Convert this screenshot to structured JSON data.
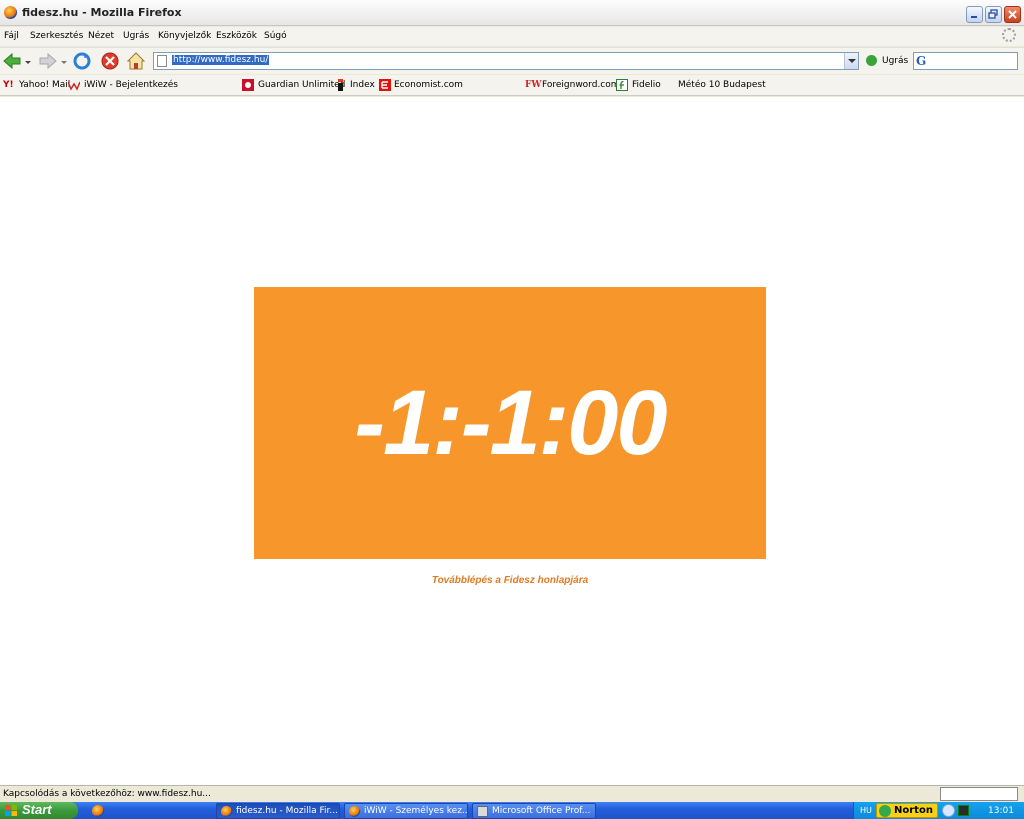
{
  "window": {
    "title": "fidesz.hu - Mozilla Firefox"
  },
  "menu": {
    "items": [
      "Fájl",
      "Szerkesztés",
      "Nézet",
      "Ugrás",
      "Könyvjelzők",
      "Eszközök",
      "Súgó"
    ]
  },
  "nav": {
    "url": "http://www.fidesz.hu/",
    "go_label": "Ugrás",
    "search_engine_icon": "G"
  },
  "bookmarks": {
    "items": [
      "Yahoo! Mail",
      "iWiW - Bejelentkezés",
      "Guardian Unlimited",
      "Index",
      "Economist.com",
      "Foreignword.com",
      "Fidelio",
      "Météo 10 Budapest"
    ]
  },
  "page": {
    "countdown": "-1:-1:00",
    "continue_link": "Továbblépés a Fidesz honlapjára",
    "accent_color": "#f7962b"
  },
  "status": {
    "text": "Kapcsolódás a következőhöz: www.fidesz.hu..."
  },
  "taskbar": {
    "start_label": "Start",
    "tasks": [
      "fidesz.hu - Mozilla Fir...",
      "iWiW - Személyes kez...",
      "Microsoft Office Prof..."
    ],
    "language": "HU",
    "norton_label": "Norton",
    "clock": "13:01"
  }
}
